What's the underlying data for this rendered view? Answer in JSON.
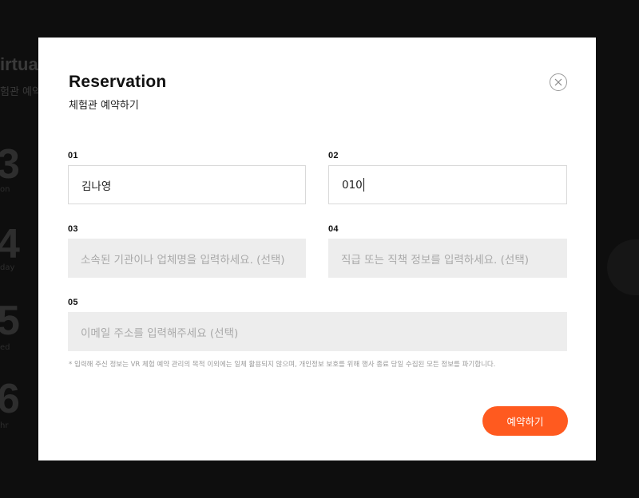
{
  "background": {
    "title_fragment": "irtua",
    "subtitle_fragment": "험관 예약",
    "stats": [
      {
        "num": "3",
        "label": "on"
      },
      {
        "num": "4",
        "label": "day"
      },
      {
        "num": "5",
        "label": "ed"
      },
      {
        "num": "6",
        "label": "hr"
      }
    ]
  },
  "modal": {
    "title": "Reservation",
    "subtitle": "체험관 예약하기",
    "close_icon": "close-icon",
    "fields": [
      {
        "num": "01",
        "value": "김나영",
        "placeholder": ""
      },
      {
        "num": "02",
        "value": "010",
        "placeholder": ""
      },
      {
        "num": "03",
        "value": "",
        "placeholder": "소속된 기관이나 업체명을 입력하세요. (선택)"
      },
      {
        "num": "04",
        "value": "",
        "placeholder": "직급 또는 직책 정보를 입력하세요. (선택)"
      },
      {
        "num": "05",
        "value": "",
        "placeholder": "이메일 주소를 입력해주세요 (선택)"
      }
    ],
    "notice": "* 입력해 주신 정보는 VR 체험 예약 관리의 목적 이외에는 일체 활용되지 않으며, 개인정보 보호를 위해 행사 종료 당일 수집된 모든 정보를 파기합니다.",
    "submit_label": "예약하기",
    "accent_color": "#ff5a1f"
  }
}
